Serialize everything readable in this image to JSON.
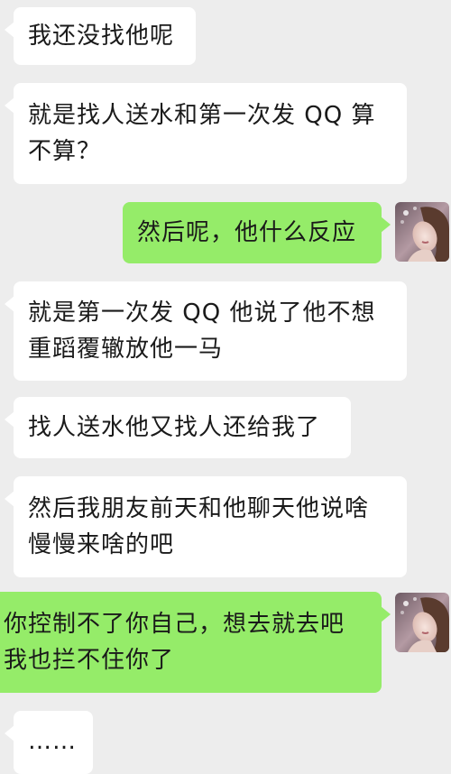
{
  "conversation": {
    "messages": [
      {
        "side": "in",
        "lines": [
          "我还没找他呢"
        ]
      },
      {
        "side": "in",
        "lines": [
          "就是找人送水和第一次发 QQ 算",
          "不算？"
        ]
      },
      {
        "side": "out",
        "lines": [
          "然后呢，他什么反应"
        ]
      },
      {
        "side": "in",
        "lines": [
          "就是第一次发 QQ 他说了他不想",
          "重蹈覆辙放他一马"
        ]
      },
      {
        "side": "in",
        "lines": [
          "找人送水他又找人还给我了"
        ]
      },
      {
        "side": "in",
        "lines": [
          "然后我朋友前天和他聊天他说啥",
          "慢慢来啥的吧"
        ]
      },
      {
        "side": "out",
        "lines": [
          "你控制不了你自己，想去就去吧",
          "我也拦不住你了"
        ]
      },
      {
        "side": "in",
        "lines": [
          "……"
        ]
      }
    ]
  },
  "colors": {
    "background": "#ededed",
    "incoming_bubble": "#ffffff",
    "outgoing_bubble": "#95ec69",
    "text": "#1a1a1a"
  },
  "icons": {
    "avatar": "user-avatar-photo"
  }
}
